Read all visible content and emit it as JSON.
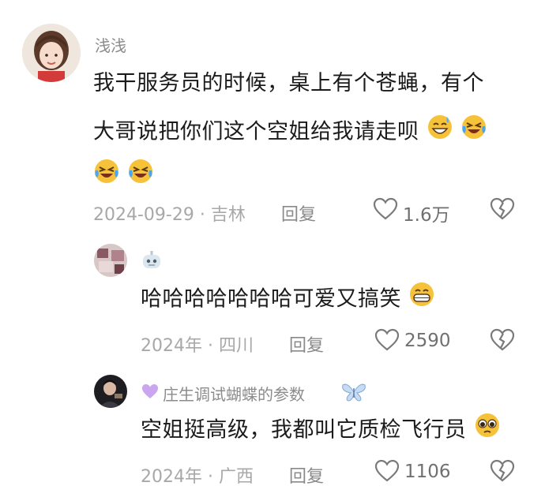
{
  "comments": [
    {
      "username": "浅浅",
      "text_line1": "我干服务员的时候，桌上有个苍蝇，有个",
      "text_line2": "大哥说把你们这个空姐给我请走呗",
      "date": "2024-09-29",
      "location": "吉林",
      "reply_label": "回复",
      "likes": "1.6万"
    },
    {
      "username": "",
      "text": "哈哈哈哈哈哈哈可爱又搞笑",
      "date": "2024年",
      "location": "四川",
      "reply_label": "回复",
      "likes": "2590"
    },
    {
      "username": "庄生调试蝴蝶的参数",
      "text": "空姐挺高级，我都叫它质检飞行员",
      "date": "2024年",
      "location": "广西",
      "reply_label": "回复",
      "likes": "1106"
    }
  ],
  "separator": "·",
  "icons": {
    "like": "heart-outline-icon",
    "dislike": "broken-heart-icon",
    "emoji_laugh_sweat": "grinning-sweat-emoji",
    "emoji_cry_laugh": "rolling-laughing-emoji",
    "emoji_grin": "grinning-teeth-emoji",
    "emoji_pleading": "pleading-face-emoji",
    "badge_robot": "robot-badge-icon",
    "purple_heart": "purple-heart-icon",
    "butterfly": "butterfly-icon"
  },
  "colors": {
    "text": "#1b1b1b",
    "meta": "#a8a8a8",
    "username": "#8c8c8c",
    "emoji": "#f6c23a"
  }
}
